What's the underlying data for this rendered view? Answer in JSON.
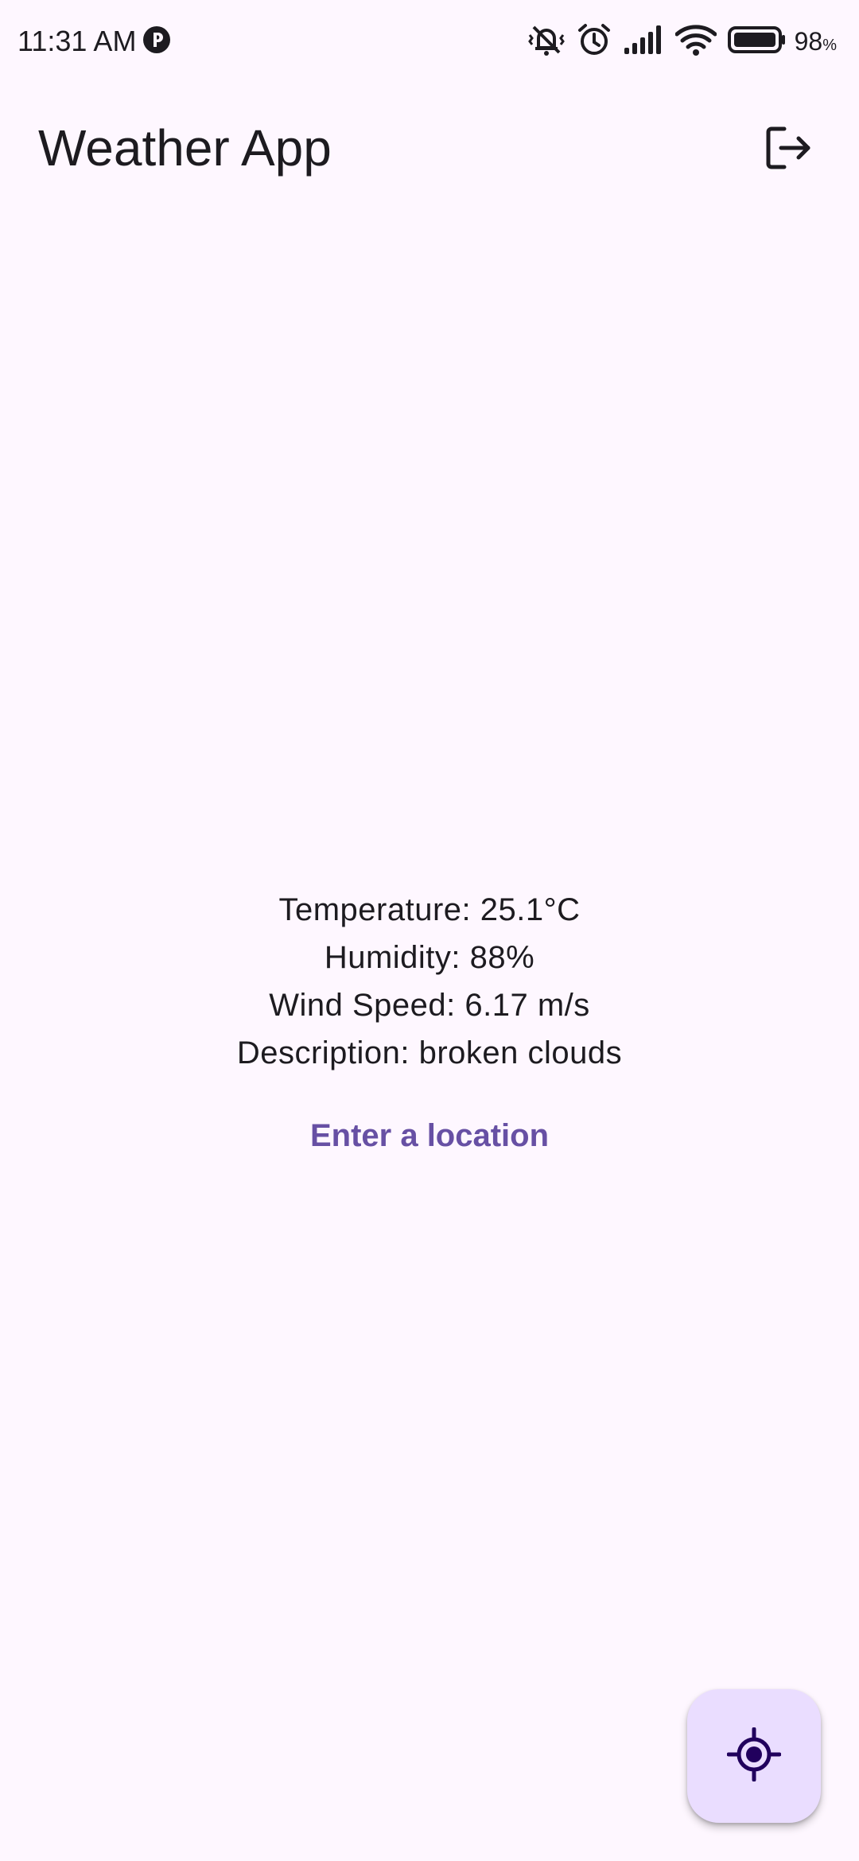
{
  "status_bar": {
    "time": "11:31 AM",
    "battery_value": "98",
    "battery_unit": "%",
    "icons": [
      "p-notification-icon",
      "vibrate-off-icon",
      "alarm-icon",
      "signal-icon",
      "wifi-icon",
      "battery-icon"
    ]
  },
  "app_bar": {
    "title": "Weather App",
    "action_icon": "logout-icon"
  },
  "weather": {
    "temperature": "Temperature: 25.1°C",
    "humidity": "Humidity: 88%",
    "wind_speed": "Wind Speed: 6.17 m/s",
    "description": "Description: broken clouds"
  },
  "actions": {
    "enter_location_label": "Enter a location",
    "fab_icon": "my-location-icon"
  },
  "colors": {
    "background": "#fef7ff",
    "text": "#1d1b20",
    "accent": "#6750a4",
    "fab_background": "#eaddff",
    "fab_icon": "#21005d"
  }
}
